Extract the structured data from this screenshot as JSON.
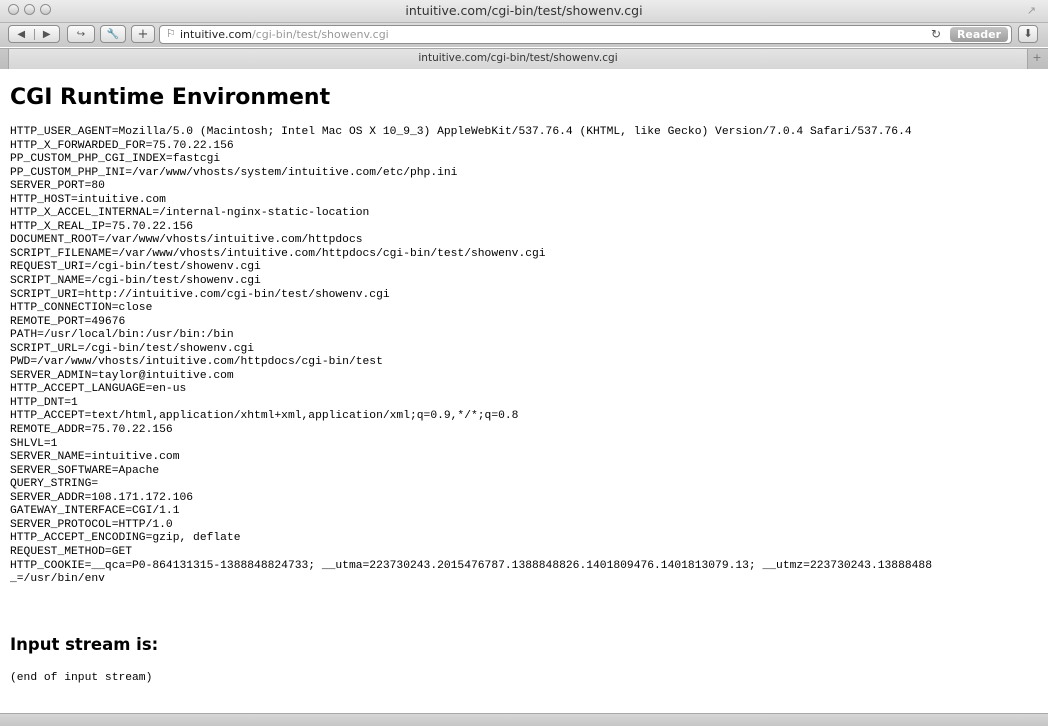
{
  "window": {
    "title": "intuitive.com/cgi-bin/test/showenv.cgi"
  },
  "toolbar": {
    "address_host": "intuitive.com",
    "address_path": "/cgi-bin/test/showenv.cgi",
    "reader_label": "Reader"
  },
  "tab": {
    "title": "intuitive.com/cgi-bin/test/showenv.cgi"
  },
  "page": {
    "title": "CGI Runtime Environment",
    "env_lines": [
      "HTTP_USER_AGENT=Mozilla/5.0 (Macintosh; Intel Mac OS X 10_9_3) AppleWebKit/537.76.4 (KHTML, like Gecko) Version/7.0.4 Safari/537.76.4",
      "HTTP_X_FORWARDED_FOR=75.70.22.156",
      "PP_CUSTOM_PHP_CGI_INDEX=fastcgi",
      "PP_CUSTOM_PHP_INI=/var/www/vhosts/system/intuitive.com/etc/php.ini",
      "SERVER_PORT=80",
      "HTTP_HOST=intuitive.com",
      "HTTP_X_ACCEL_INTERNAL=/internal-nginx-static-location",
      "HTTP_X_REAL_IP=75.70.22.156",
      "DOCUMENT_ROOT=/var/www/vhosts/intuitive.com/httpdocs",
      "SCRIPT_FILENAME=/var/www/vhosts/intuitive.com/httpdocs/cgi-bin/test/showenv.cgi",
      "REQUEST_URI=/cgi-bin/test/showenv.cgi",
      "SCRIPT_NAME=/cgi-bin/test/showenv.cgi",
      "SCRIPT_URI=http://intuitive.com/cgi-bin/test/showenv.cgi",
      "HTTP_CONNECTION=close",
      "REMOTE_PORT=49676",
      "PATH=/usr/local/bin:/usr/bin:/bin",
      "SCRIPT_URL=/cgi-bin/test/showenv.cgi",
      "PWD=/var/www/vhosts/intuitive.com/httpdocs/cgi-bin/test",
      "SERVER_ADMIN=taylor@intuitive.com",
      "HTTP_ACCEPT_LANGUAGE=en-us",
      "HTTP_DNT=1",
      "HTTP_ACCEPT=text/html,application/xhtml+xml,application/xml;q=0.9,*/*;q=0.8",
      "REMOTE_ADDR=75.70.22.156",
      "SHLVL=1",
      "SERVER_NAME=intuitive.com",
      "SERVER_SOFTWARE=Apache",
      "QUERY_STRING=",
      "SERVER_ADDR=108.171.172.106",
      "GATEWAY_INTERFACE=CGI/1.1",
      "SERVER_PROTOCOL=HTTP/1.0",
      "HTTP_ACCEPT_ENCODING=gzip, deflate",
      "REQUEST_METHOD=GET",
      "HTTP_COOKIE=__qca=P0-864131315-1388848824733; __utma=223730243.2015476787.1388848826.1401809476.1401813079.13; __utmz=223730243.13888488",
      "_=/usr/bin/env"
    ],
    "input_heading": "Input stream is:",
    "input_end": "(end of input stream)"
  }
}
